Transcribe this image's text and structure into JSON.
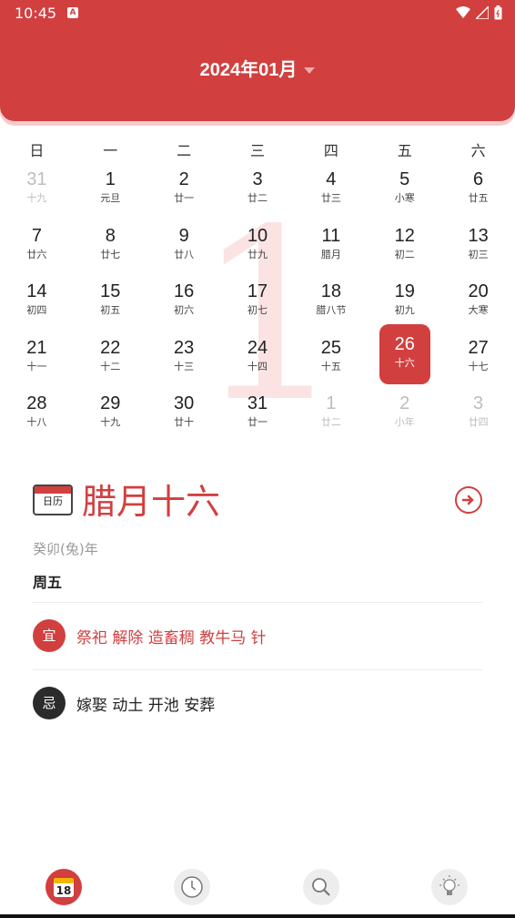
{
  "status": {
    "time": "10:45",
    "a_badge": "A"
  },
  "header": {
    "title": "2024年01月"
  },
  "weekdays": [
    "日",
    "一",
    "二",
    "三",
    "四",
    "五",
    "六"
  ],
  "calendar": {
    "watermark": "1",
    "days": [
      {
        "d": "31",
        "l": "十九"
      },
      {
        "d": "1",
        "l": "元旦"
      },
      {
        "d": "2",
        "l": "廿一"
      },
      {
        "d": "3",
        "l": "廿二"
      },
      {
        "d": "4",
        "l": "廿三"
      },
      {
        "d": "5",
        "l": "小寒"
      },
      {
        "d": "6",
        "l": "廿五"
      },
      {
        "d": "7",
        "l": "廿六"
      },
      {
        "d": "8",
        "l": "廿七"
      },
      {
        "d": "9",
        "l": "廿八"
      },
      {
        "d": "10",
        "l": "廿九"
      },
      {
        "d": "11",
        "l": "腊月"
      },
      {
        "d": "12",
        "l": "初二"
      },
      {
        "d": "13",
        "l": "初三"
      },
      {
        "d": "14",
        "l": "初四"
      },
      {
        "d": "15",
        "l": "初五"
      },
      {
        "d": "16",
        "l": "初六"
      },
      {
        "d": "17",
        "l": "初七"
      },
      {
        "d": "18",
        "l": "腊八节"
      },
      {
        "d": "19",
        "l": "初九"
      },
      {
        "d": "20",
        "l": "大寒"
      },
      {
        "d": "21",
        "l": "十一"
      },
      {
        "d": "22",
        "l": "十二"
      },
      {
        "d": "23",
        "l": "十三"
      },
      {
        "d": "24",
        "l": "十四"
      },
      {
        "d": "25",
        "l": "十五"
      },
      {
        "d": "26",
        "l": "十六"
      },
      {
        "d": "27",
        "l": "十七"
      },
      {
        "d": "28",
        "l": "十八"
      },
      {
        "d": "29",
        "l": "十九"
      },
      {
        "d": "30",
        "l": "廿十"
      },
      {
        "d": "31",
        "l": "廿一"
      },
      {
        "d": "1",
        "l": "廿二"
      },
      {
        "d": "2",
        "l": "小年"
      },
      {
        "d": "3",
        "l": "廿四"
      }
    ]
  },
  "detail": {
    "badge_label": "日历",
    "lunar_day": "腊月十六",
    "year": "癸卯(兔)年",
    "weekday": "周五",
    "yi_label": "宜",
    "yi_text": "祭祀 解除 造畜稠 教牛马 针",
    "ji_label": "忌",
    "ji_text": "嫁娶 动土 开池 安葬"
  },
  "nav": {
    "calendar_day": "18"
  }
}
